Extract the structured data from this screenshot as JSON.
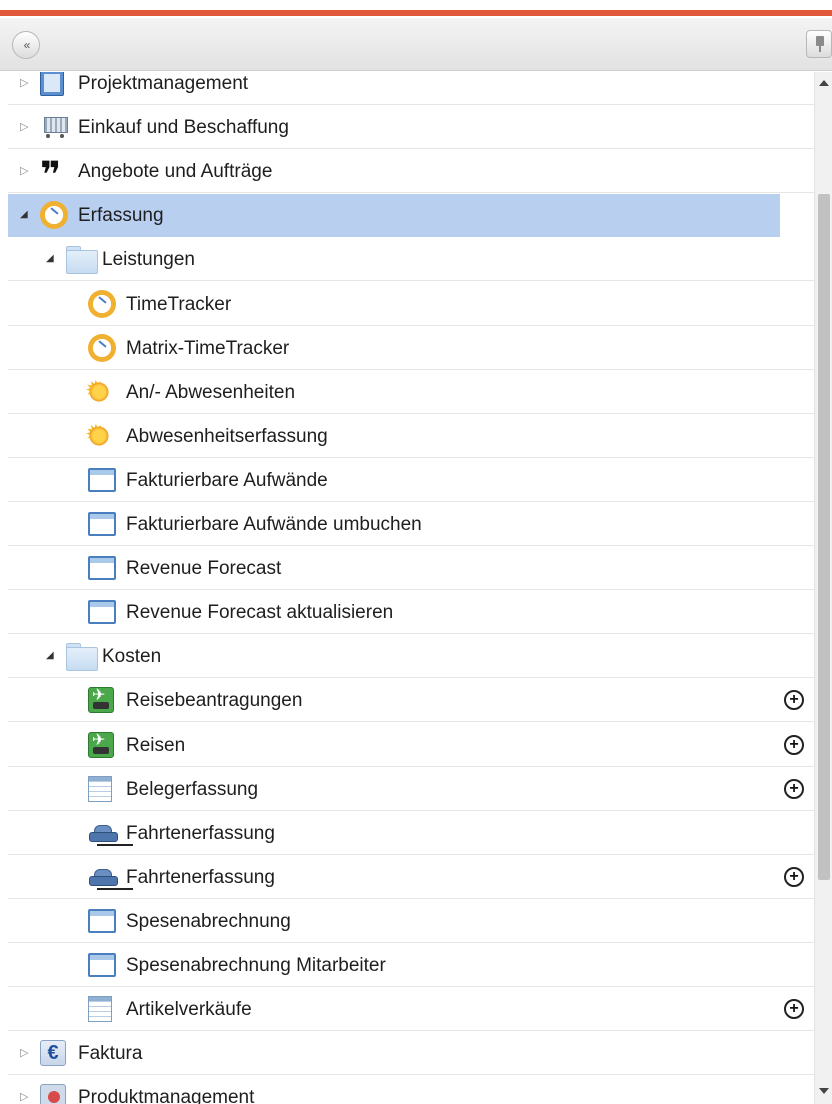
{
  "toolbar": {
    "collapse_glyph": "«",
    "accent_color": "#e05a3a"
  },
  "tree": {
    "rows": [
      {
        "label": "Projektmanagement",
        "icon": "calculator-icon",
        "level": 0,
        "state": "collapsed"
      },
      {
        "label": "Einkauf und Beschaffung",
        "icon": "cart-icon",
        "level": 0,
        "state": "collapsed"
      },
      {
        "label": "Angebote und Aufträge",
        "icon": "quote-icon",
        "level": 0,
        "state": "collapsed"
      },
      {
        "label": "Erfassung",
        "icon": "clock-icon",
        "level": 0,
        "state": "expanded",
        "selected": true
      },
      {
        "label": "Leistungen",
        "icon": "folder-icon",
        "level": 1,
        "state": "expanded"
      },
      {
        "label": "TimeTracker",
        "icon": "clock-icon",
        "level": 2
      },
      {
        "label": "Matrix-TimeTracker",
        "icon": "clock-icon",
        "level": 2
      },
      {
        "label": "An/- Abwesenheiten",
        "icon": "sun-icon",
        "level": 2
      },
      {
        "label": "Abwesenheitserfassung",
        "icon": "sun-icon",
        "level": 2
      },
      {
        "label": "Fakturierbare Aufwände",
        "icon": "window-icon",
        "level": 2
      },
      {
        "label": "Fakturierbare Aufwände umbuchen",
        "icon": "window-icon",
        "level": 2
      },
      {
        "label": "Revenue Forecast",
        "icon": "window-icon",
        "level": 2
      },
      {
        "label": "Revenue Forecast aktualisieren",
        "icon": "window-icon",
        "level": 2
      },
      {
        "label": "Kosten",
        "icon": "folder-icon",
        "level": 1,
        "state": "expanded"
      },
      {
        "label": "Reisebeantragungen",
        "icon": "travel-icon",
        "level": 2,
        "add": true
      },
      {
        "label": "Reisen",
        "icon": "travel-icon",
        "level": 2,
        "add": true
      },
      {
        "label": "Belegerfassung",
        "icon": "grid-icon",
        "level": 2,
        "add": true
      },
      {
        "label": "Fahrtenerfassung",
        "icon": "car-icon",
        "level": 2
      },
      {
        "label": "Fahrtenerfassung",
        "icon": "car-icon",
        "level": 2,
        "add": true
      },
      {
        "label": "Spesenabrechnung",
        "icon": "window-icon",
        "level": 2
      },
      {
        "label": "Spesenabrechnung Mitarbeiter",
        "icon": "window-icon",
        "level": 2
      },
      {
        "label": "Artikelverkäufe",
        "icon": "grid-icon",
        "level": 2,
        "add": true
      },
      {
        "label": "Faktura",
        "icon": "euro-icon",
        "level": 0,
        "state": "collapsed"
      },
      {
        "label": "Produktmanagement",
        "icon": "product-icon",
        "level": 0,
        "state": "collapsed"
      }
    ],
    "expander_collapsed": "▷",
    "expander_expanded": "◢",
    "add_glyph": "+",
    "selected_color": "#b8cff0"
  }
}
